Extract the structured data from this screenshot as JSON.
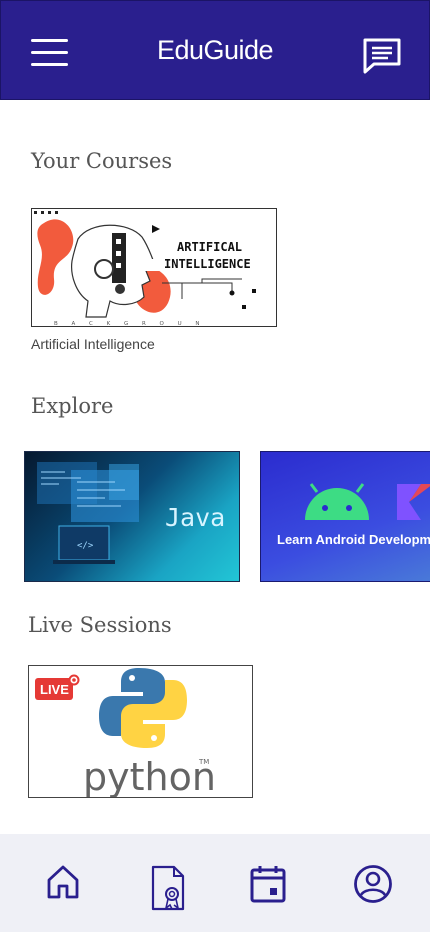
{
  "app": {
    "title": "EduGuide"
  },
  "sections": {
    "courses_title": "Your Courses",
    "explore_title": "Explore",
    "live_title": "Live Sessions"
  },
  "courses": [
    {
      "name": "Artificial Intelligence",
      "image_text_line1": "ARTIFICAL",
      "image_text_line2": "INTELLIGENCE",
      "image_footer": "B A C K G R O U N"
    }
  ],
  "explore": [
    {
      "label": "Java"
    },
    {
      "label": "Learn Android Developm"
    }
  ],
  "live": [
    {
      "badge": "LIVE",
      "label": "python",
      "tm": "TM"
    }
  ],
  "bottom_nav": [
    "home-icon",
    "certificate-icon",
    "calendar-icon",
    "profile-icon"
  ],
  "colors": {
    "header": "#2a1f8e",
    "nav_bg": "#eff0f6",
    "nav_icon": "#2a1f8e"
  }
}
